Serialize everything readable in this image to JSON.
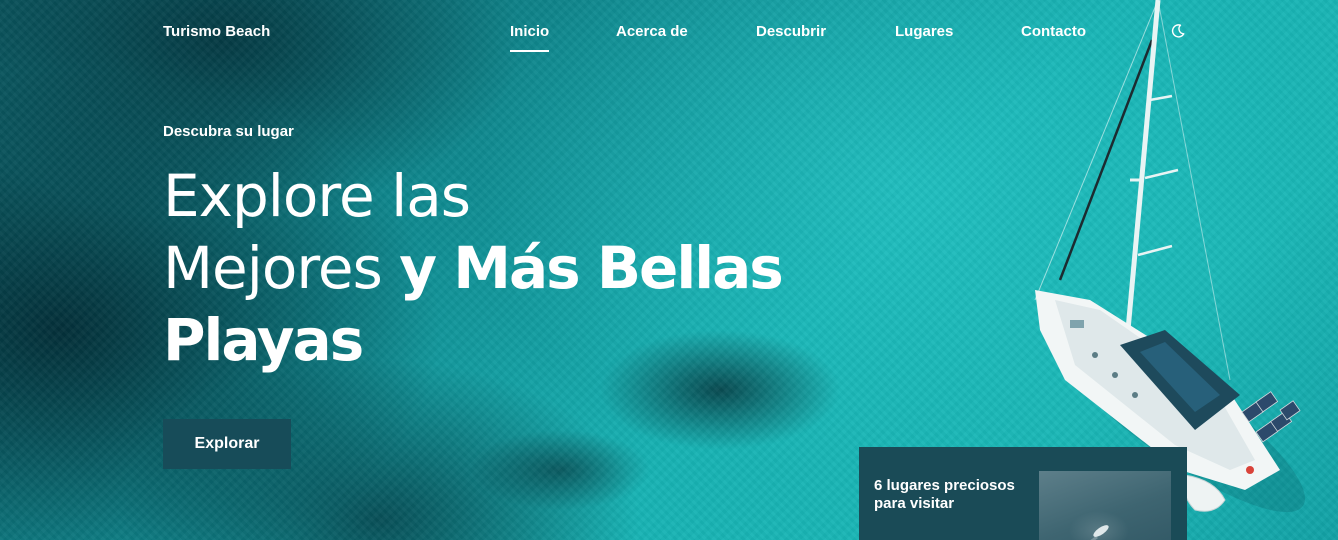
{
  "header": {
    "logo": "Turismo Beach",
    "nav": [
      {
        "label": "Inicio",
        "active": true
      },
      {
        "label": "Acerca de",
        "active": false
      },
      {
        "label": "Descubrir",
        "active": false
      },
      {
        "label": "Lugares",
        "active": false
      },
      {
        "label": "Contacto",
        "active": false
      }
    ],
    "theme_icon": "moon-icon"
  },
  "hero": {
    "subtitle": "Descubra su lugar",
    "title_line1": "Explore las",
    "title_line2_regular": "Mejores",
    "title_line2_bold": "y Más Bellas",
    "title_line3_bold": "Playas",
    "button_label": "Explorar"
  },
  "card": {
    "text": "6 lugares preciosos para visitar"
  },
  "colors": {
    "accent": "#174c59",
    "card_bg": "#1a4b57",
    "sea": "#17b3b4"
  }
}
